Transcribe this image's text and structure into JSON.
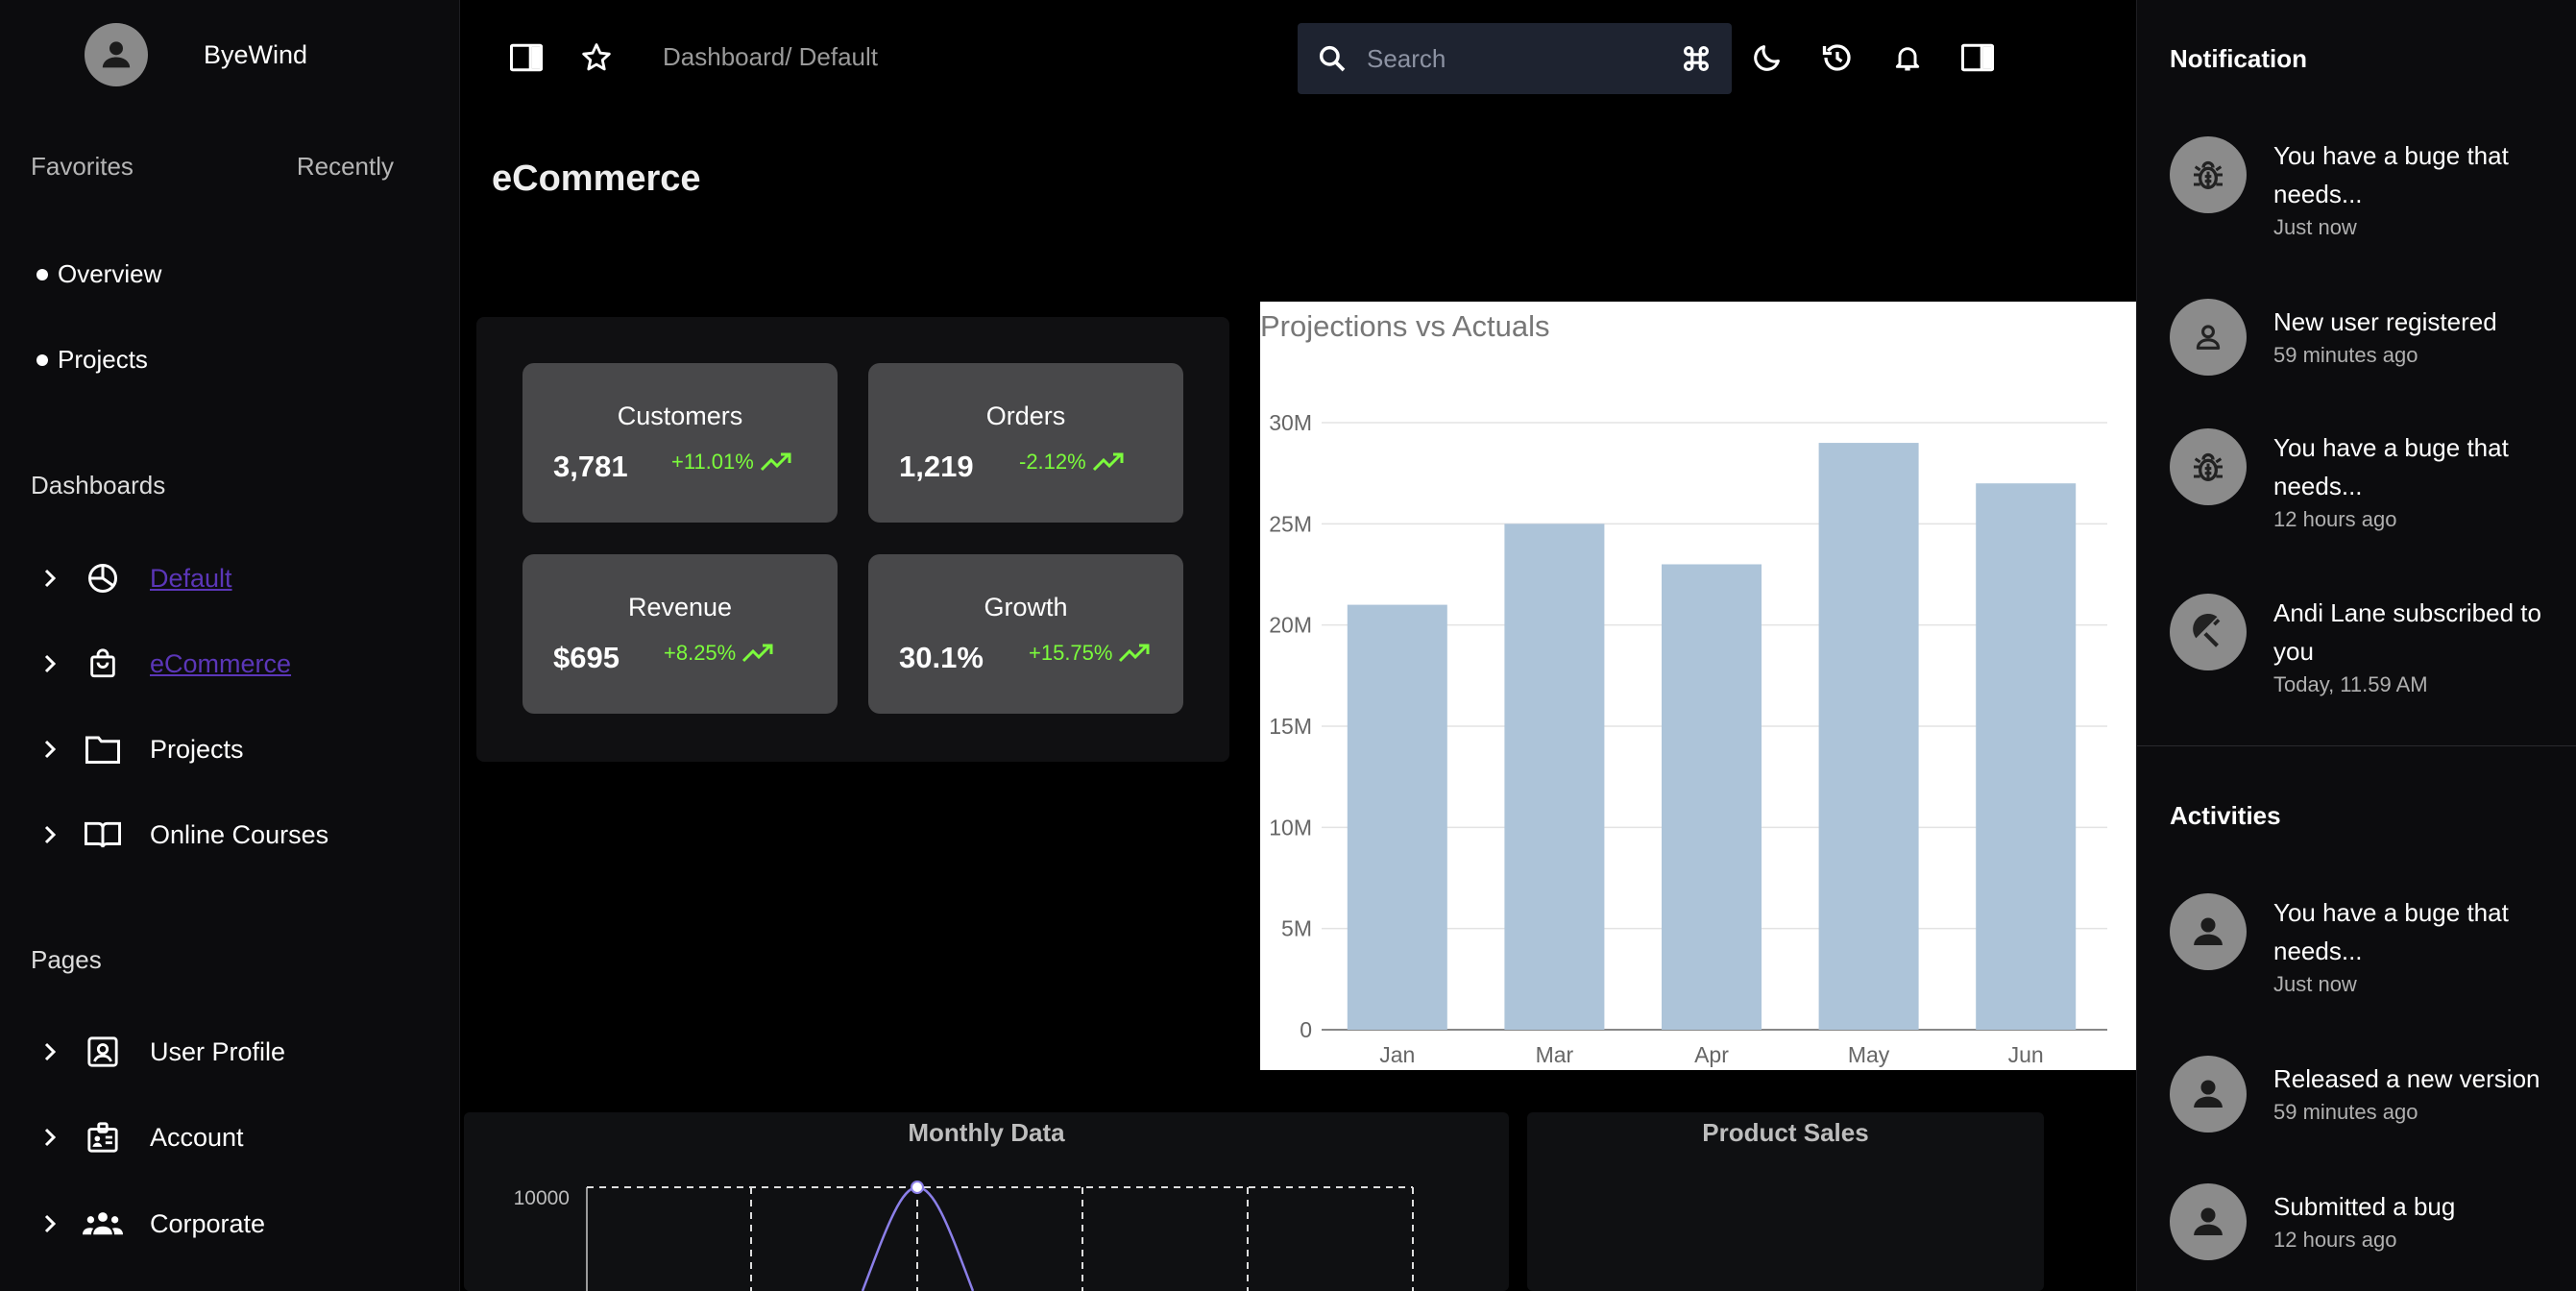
{
  "sidebar": {
    "brand": "ByeWind",
    "tabs": [
      "Favorites",
      "Recently"
    ],
    "favorites": [
      "Overview",
      "Projects"
    ],
    "dashboards_title": "Dashboards",
    "dashboards": [
      {
        "label": "Default",
        "icon": "pie-chart-icon"
      },
      {
        "label": "eCommerce",
        "icon": "shopping-bag-icon"
      },
      {
        "label": "Projects",
        "icon": "folder-icon"
      },
      {
        "label": "Online Courses",
        "icon": "book-icon"
      }
    ],
    "pages_title": "Pages",
    "pages": [
      {
        "label": "User Profile",
        "icon": "user-profile-icon"
      },
      {
        "label": "Account",
        "icon": "id-card-icon"
      },
      {
        "label": "Corporate",
        "icon": "group-icon"
      }
    ]
  },
  "topbar": {
    "breadcrumb": "Dashboard/ Default",
    "search_placeholder": "Search"
  },
  "page_title": "eCommerce",
  "stats": [
    {
      "label": "Customers",
      "value": "3,781",
      "delta": "+11.01%"
    },
    {
      "label": "Orders",
      "value": "1,219",
      "delta": "-2.12%"
    },
    {
      "label": "Revenue",
      "value": "$695",
      "delta": "+8.25%"
    },
    {
      "label": "Growth",
      "value": "30.1%",
      "delta": "+15.75%"
    }
  ],
  "chart_data": {
    "type": "bar",
    "title": "Projections vs Actuals",
    "categories": [
      "Jan",
      "Mar",
      "Apr",
      "May",
      "Jun"
    ],
    "values": [
      21,
      25,
      23,
      29,
      27
    ],
    "yticks": [
      "0",
      "5M",
      "10M",
      "15M",
      "20M",
      "25M",
      "30M"
    ],
    "ylim": [
      0,
      30
    ],
    "grid": true,
    "bar_color": "#adc4d9"
  },
  "monthly": {
    "title": "Monthly Data",
    "ytick": "10000"
  },
  "product": {
    "title": "Product Sales"
  },
  "notifications": {
    "title": "Notification",
    "items": [
      {
        "msg": "You have a buge that needs...",
        "time": "Just now",
        "icon": "bug-icon"
      },
      {
        "msg": "New user registered",
        "time": "59 minutes ago",
        "icon": "user-icon"
      },
      {
        "msg": "You have a buge that needs...",
        "time": "12 hours ago",
        "icon": "bug-icon"
      },
      {
        "msg": "Andi Lane subscribed to you",
        "time": "Today, 11.59 AM",
        "icon": "broadcast-icon"
      }
    ]
  },
  "activities": {
    "title": "Activities",
    "items": [
      {
        "msg": "You have a buge that needs...",
        "time": "Just now"
      },
      {
        "msg": "Released a new version",
        "time": "59 minutes ago"
      },
      {
        "msg": "Submitted a bug",
        "time": "12 hours ago"
      }
    ]
  },
  "colors": {
    "accent_link": "#5b36b8",
    "positive": "#7cfc3c",
    "card": "#48484a"
  }
}
